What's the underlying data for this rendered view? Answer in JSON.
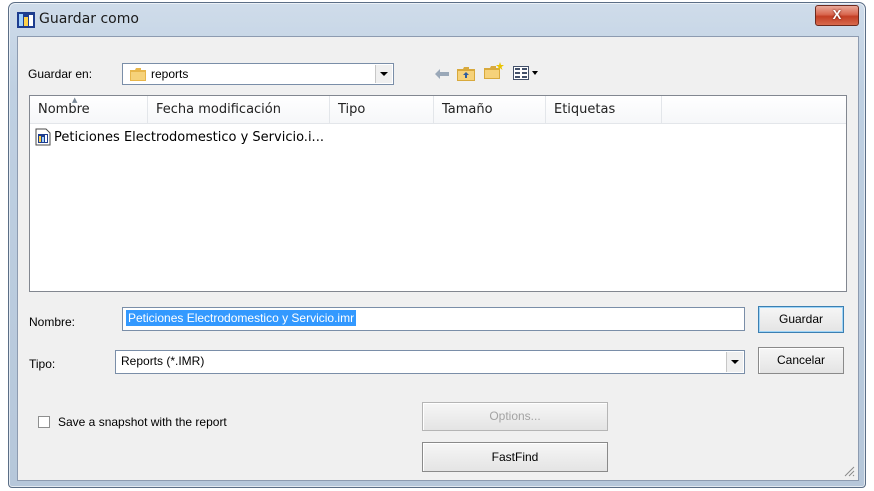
{
  "window": {
    "title": "Guardar como",
    "close_symbol": "X"
  },
  "location": {
    "label": "Guardar en:",
    "value": "reports",
    "icon": "folder-icon"
  },
  "toolbar": {
    "icons": [
      "back-arrow-icon",
      "up-folder-icon",
      "new-folder-icon",
      "view-menu-icon"
    ]
  },
  "file_list": {
    "columns": [
      "Nombre",
      "Fecha modificación",
      "Tipo",
      "Tamaño",
      "Etiquetas"
    ],
    "items": [
      {
        "name": "Peticiones Electrodomestico y Servicio.i...",
        "icon": "report-file-icon"
      }
    ]
  },
  "filename": {
    "label": "Nombre:",
    "value": "Peticiones Electrodomestico y Servicio.imr"
  },
  "filetype": {
    "label": "Tipo:",
    "value": "Reports (*.IMR)"
  },
  "buttons": {
    "save": "Guardar",
    "cancel": "Cancelar",
    "options": "Options...",
    "fastfind": "FastFind"
  },
  "snapshot": {
    "label": "Save a snapshot with the report",
    "checked": false
  },
  "colors": {
    "selection": "#3399ff",
    "close_button": "#c9452a",
    "frame": "#bfd0e2"
  }
}
